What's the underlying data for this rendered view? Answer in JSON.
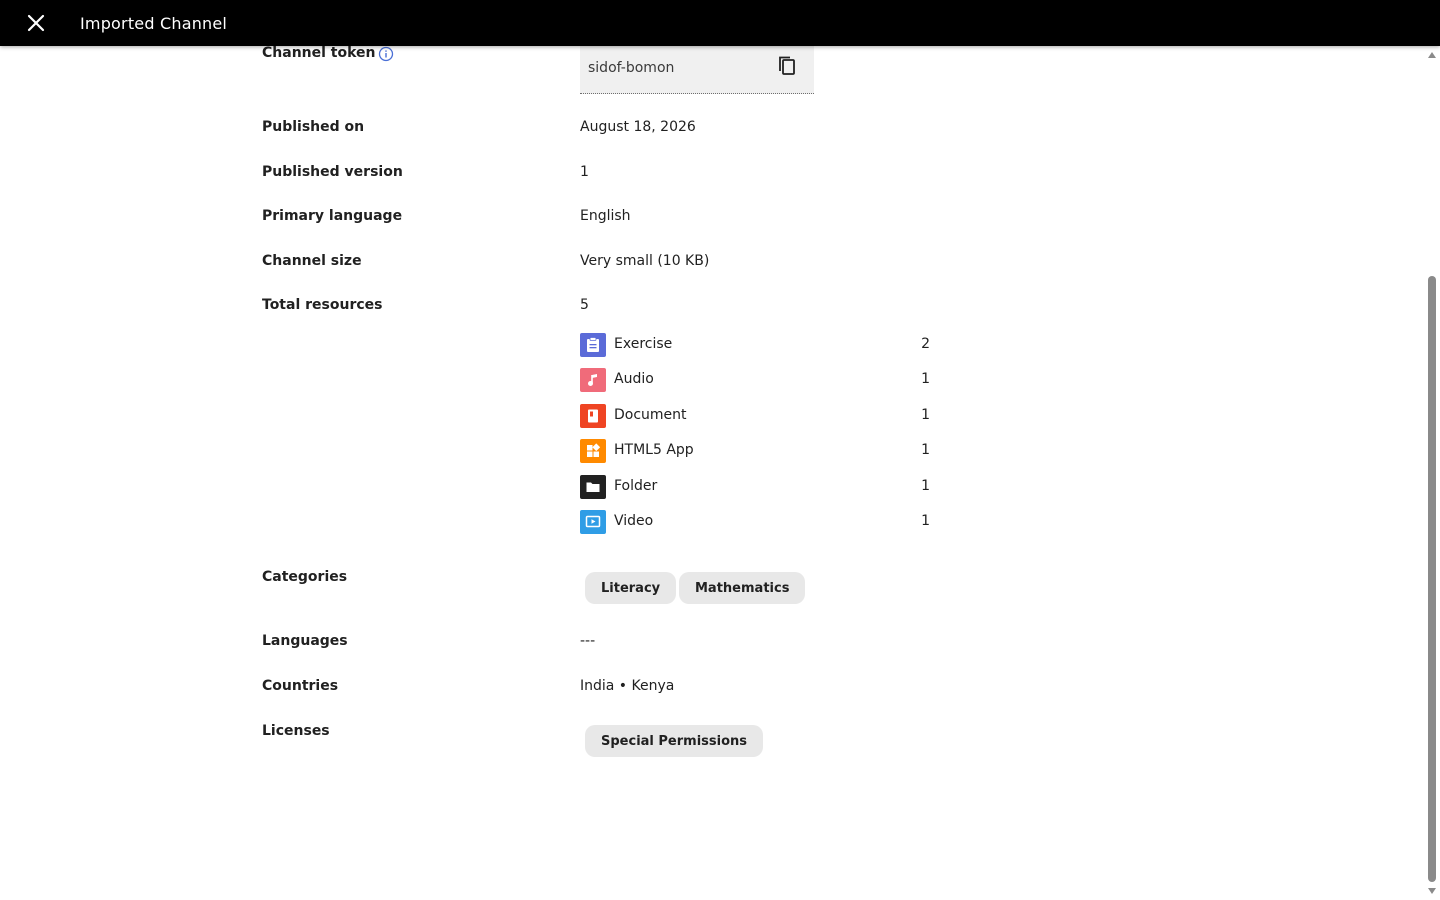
{
  "app_bar": {
    "title": "Imported Channel",
    "close_icon": "close-icon"
  },
  "details": {
    "channel_token": {
      "label": "Channel token",
      "value": "sidof-bomon",
      "info_icon": "info-icon",
      "copy_icon": "copy-icon"
    },
    "published_on": {
      "label": "Published on",
      "value": "August 18, 2026"
    },
    "published_version": {
      "label": "Published version",
      "value": "1"
    },
    "primary_language": {
      "label": "Primary language",
      "value": "English"
    },
    "channel_size": {
      "label": "Channel size",
      "value": "Very small (10 KB)"
    },
    "total_resources": {
      "label": "Total resources",
      "value": "5",
      "items": [
        {
          "label": "Exercise",
          "count": "2",
          "icon": "exercise-icon",
          "color": "#5b6bd8"
        },
        {
          "label": "Audio",
          "count": "1",
          "icon": "audio-icon",
          "color": "#f06b7a"
        },
        {
          "label": "Document",
          "count": "1",
          "icon": "document-icon",
          "color": "#ef4423"
        },
        {
          "label": "HTML5 App",
          "count": "1",
          "icon": "html5-app-icon",
          "color": "#ff8a00"
        },
        {
          "label": "Folder",
          "count": "1",
          "icon": "folder-icon",
          "color": "#212121"
        },
        {
          "label": "Video",
          "count": "1",
          "icon": "video-icon",
          "color": "#2f9de6"
        }
      ]
    },
    "categories": {
      "label": "Categories",
      "chips": [
        "Literacy",
        "Mathematics"
      ]
    },
    "languages": {
      "label": "Languages",
      "value": "---"
    },
    "countries": {
      "label": "Countries",
      "value": "India • Kenya"
    },
    "licenses": {
      "label": "Licenses",
      "chips": [
        "Special Permissions"
      ]
    }
  },
  "colors": {
    "app_bar_bg": "#000000",
    "chip_bg": "#e8e8e8",
    "token_bg": "#f0f0f0",
    "info_accent": "#4a6fd6"
  }
}
